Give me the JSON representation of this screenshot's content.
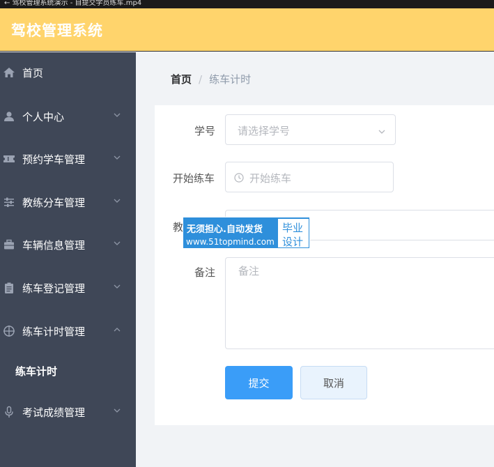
{
  "window": {
    "title_fragment": "← 驾校管理系统演示 - 自提交学员练车.mp4"
  },
  "header": {
    "title": "驾校管理系统"
  },
  "sidebar": {
    "items": [
      {
        "label": "首页"
      },
      {
        "label": "个人中心"
      },
      {
        "label": "预约学车管理"
      },
      {
        "label": "教练分车管理"
      },
      {
        "label": "车辆信息管理"
      },
      {
        "label": "练车登记管理"
      },
      {
        "label": "练车计时管理",
        "submenu": [
          {
            "label": "练车计时"
          }
        ]
      },
      {
        "label": "考试成绩管理"
      }
    ]
  },
  "breadcrumb": {
    "home": "首页",
    "separator": "/",
    "current": "练车计时"
  },
  "form": {
    "student": {
      "label": "学号",
      "placeholder": "请选择学号"
    },
    "start": {
      "label": "开始练车",
      "placeholder": "开始练车"
    },
    "coach": {
      "label": "教"
    },
    "remark": {
      "label": "备注",
      "placeholder": "备注"
    },
    "submit_label": "提交",
    "cancel_label": "取消"
  },
  "watermark": {
    "line1": "无须担心.自动发货",
    "line2": "www.51topmind.com",
    "box_line1": "毕业",
    "box_line2": "设计"
  },
  "colors": {
    "header": "#ffd46c",
    "sidebar": "#3f4757",
    "primary": "#3a9df8",
    "watermark": "#2e8fdb"
  }
}
